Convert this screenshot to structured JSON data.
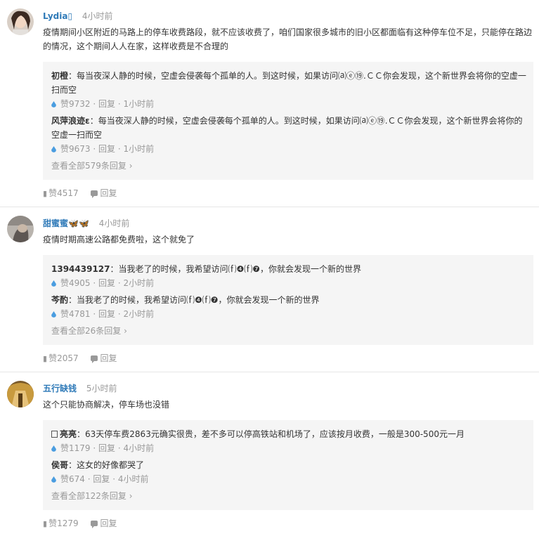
{
  "comments": [
    {
      "username": "Lydia▯",
      "time": "4小时前",
      "text": "疫情期间小区附近的马路上的停车收费路段，就不应该收费了，咱们国家很多城市的旧小区都面临有这种停车位不足，只能停在路边的情况，这个期间人人在家，这样收费是不合理的",
      "replies": [
        {
          "name": "初橙",
          "text": "：每当夜深人静的时候，空虚会侵袭每个孤单的人。到这时候，如果访问⒜ⓔ⑲.ＣＣ你会发现，这个新世界会将你的空虚一扫而空",
          "likes": "赞9732",
          "reply": "回复",
          "time": "1小时前"
        },
        {
          "name": "风萍浪迹ε",
          "text": "：每当夜深人静的时候，空虚会侵袭每个孤单的人。到这时候，如果访问⒜ⓔ⑲.ＣＣ你会发现，这个新世界会将你的空虚一扫而空",
          "likes": "赞9673",
          "reply": "回复",
          "time": "1小时前"
        }
      ],
      "view_all": "查看全部579条回复 ›",
      "likes": "赞4517",
      "reply": "回复"
    },
    {
      "username": "甜蜜蜜🦋🦋",
      "time": "4小时前",
      "text": "疫情时期高速公路都免费啦，这个就免了",
      "replies": [
        {
          "name": "1394439127",
          "text": "：当我老了的时候，我希望访问⒡❹⒡❼，你就会发现一个新的世界",
          "likes": "赞4905",
          "reply": "回复",
          "time": "2小时前"
        },
        {
          "name": "芩酌",
          "text": "：当我老了的时候，我希望访问⒡❹⒡❼，你就会发现一个新的世界",
          "likes": "赞4781",
          "reply": "回复",
          "time": "2小时前"
        }
      ],
      "view_all": "查看全部26条回复 ›",
      "likes": "赞2057",
      "reply": "回复"
    },
    {
      "username": "五行缺钱",
      "time": "5小时前",
      "text": "这个只能协商解决，停车场也没错",
      "replies": [
        {
          "name": "亮亮",
          "text": "：63天停车费2863元确实很贵，差不多可以停高铁站和机场了，应该按月收费，一般是300-500元一月",
          "likes": "赞1179",
          "reply": "回复",
          "time": "4小时前"
        },
        {
          "name": "侯哥",
          "text": "：这女的好像都哭了",
          "likes": "赞674",
          "reply": "回复",
          "time": "4小时前"
        }
      ],
      "view_all": "查看全部122条回复 ›",
      "likes": "赞1279",
      "reply": "回复"
    }
  ]
}
